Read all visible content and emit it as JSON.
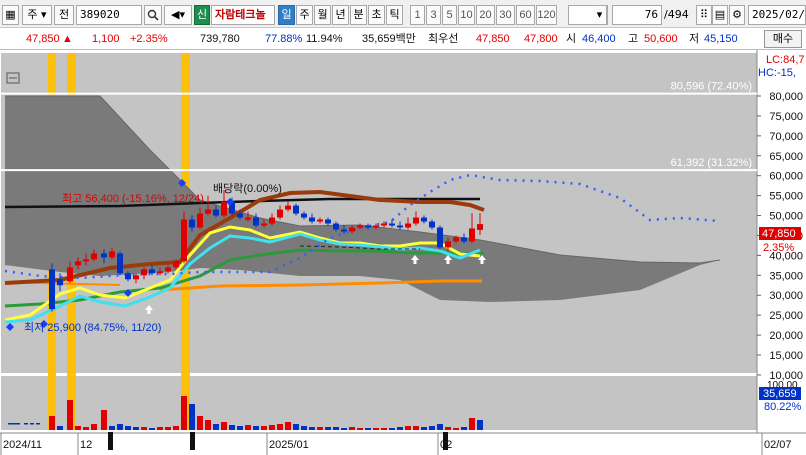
{
  "toolbar": {
    "market": "주",
    "type": "전",
    "code": "389020",
    "code_label": "신",
    "stock_name": "자람테크놀",
    "periods": [
      "일",
      "주",
      "월",
      "년",
      "분",
      "초",
      "틱"
    ],
    "active_period": "일",
    "numbers": [
      "1",
      "3",
      "5",
      "10",
      "20",
      "30",
      "60",
      "120"
    ],
    "page_counter": "76",
    "page_total": "/494",
    "date": "2025/02/"
  },
  "quote": {
    "price": "47,850",
    "change": "1,100",
    "change_pct": "+2.35%",
    "volume": "739,780",
    "turnover_pct": "77.88%",
    "foreign_pct": "11.94%",
    "amount": "35,659백만",
    "best_ask_label": "최우선",
    "best_ask": "47,850",
    "best_bid": "47,800",
    "open_label": "시",
    "open": "46,400",
    "high_label": "고",
    "high": "50,600",
    "low_label": "저",
    "low": "45,150",
    "buy_button": "매수"
  },
  "chart": {
    "lc_label": "LC:84,7",
    "hc_label": "HC:-15,",
    "levels": [
      {
        "label": "80,596 (72.40%)",
        "value": 80596
      },
      {
        "label": "61,392 (31.32%)",
        "value": 61392
      }
    ],
    "high_annotation": "최고 56,400 (-15.16%, 12/24)",
    "low_annotation": "최저 25,900 (84.75%, 11/20)",
    "dividend_annotation": "배당락(0.00%)",
    "current_price_box": "47,850",
    "current_pct_box": "2.35%",
    "y_axis": [
      "80,000",
      "75,000",
      "70,000",
      "65,000",
      "60,000",
      "55,000",
      "50,000",
      "45,000",
      "40,000",
      "35,000",
      "30,000",
      "25,000",
      "20,000",
      "15,000",
      "10,000"
    ],
    "volume_axis_top": "100.00",
    "volume_value_box": "35,659",
    "volume_pct_box": "80.22%",
    "x_axis": [
      {
        "label": "2024/11"
      },
      {
        "label": "12"
      },
      {
        "label": "2025/01"
      },
      {
        "label": "02"
      },
      {
        "label": "02/07"
      }
    ]
  },
  "colors": {
    "up": "#e00000",
    "down": "#0032c8",
    "cloud": "#7a7a7a",
    "chart_bg": "#c4c4c4",
    "highlight": "#ffc000"
  }
}
